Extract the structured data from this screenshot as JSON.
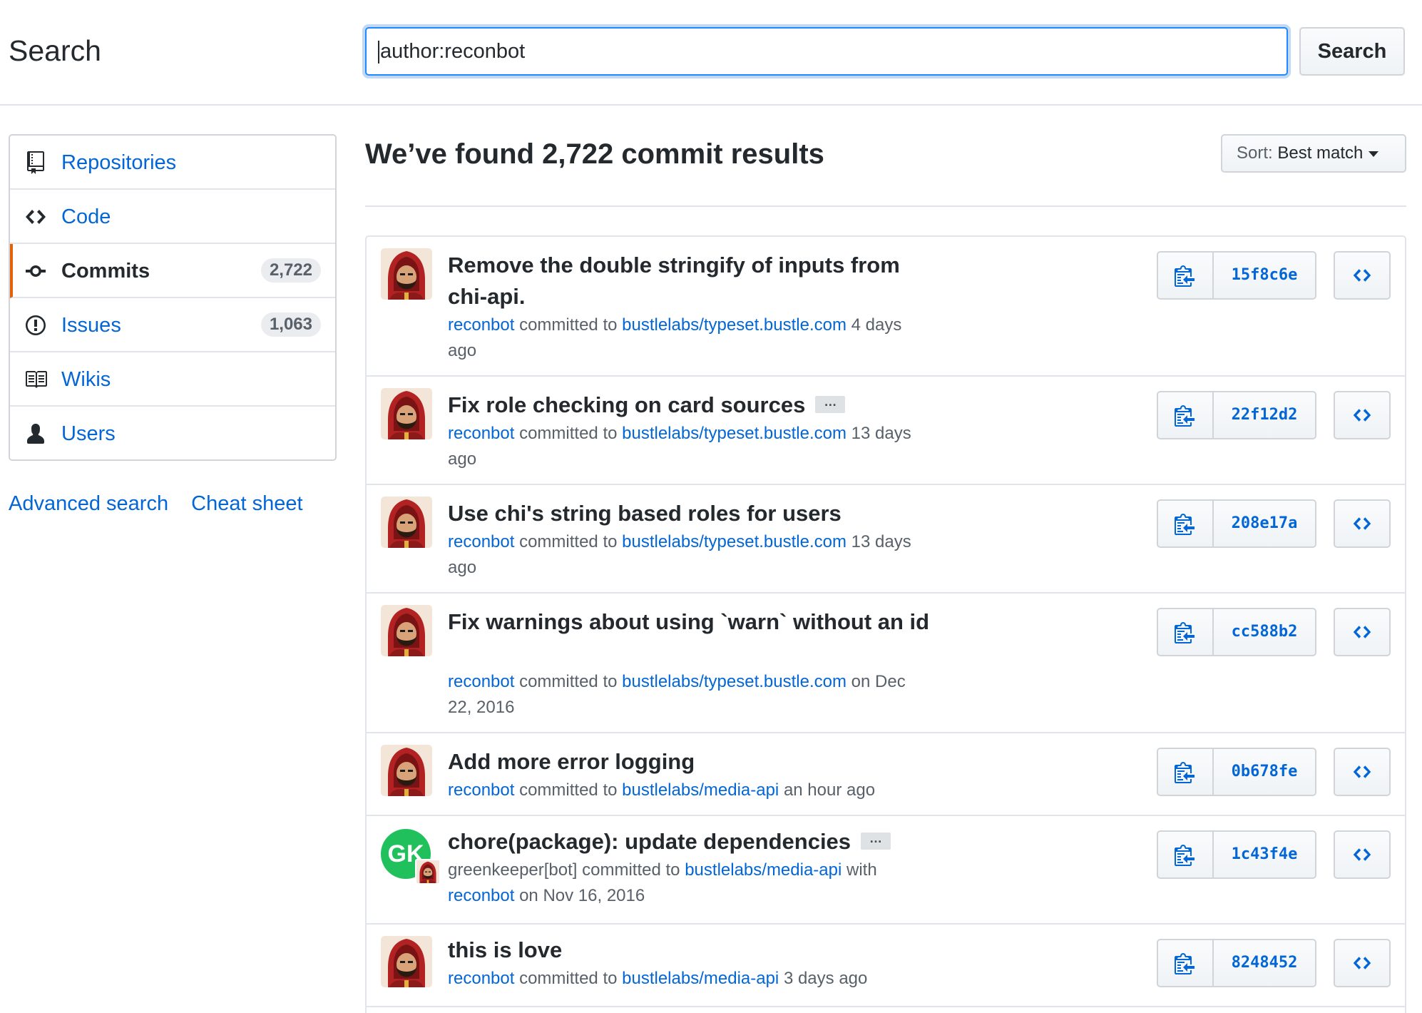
{
  "header": {
    "title": "Search",
    "query": "author:reconbot",
    "search_button": "Search"
  },
  "sidebar": {
    "items": [
      {
        "label": "Repositories",
        "icon": "repo-icon"
      },
      {
        "label": "Code",
        "icon": "code-icon"
      },
      {
        "label": "Commits",
        "icon": "commit-icon",
        "count": "2,722",
        "selected": true
      },
      {
        "label": "Issues",
        "icon": "issue-icon",
        "count": "1,063"
      },
      {
        "label": "Wikis",
        "icon": "book-icon"
      },
      {
        "label": "Users",
        "icon": "person-icon"
      }
    ],
    "links": {
      "advanced": "Advanced search",
      "cheat": "Cheat sheet"
    }
  },
  "main": {
    "results_title": "We’ve found 2,722 commit results",
    "sort_prefix": "Sort:",
    "sort_value": "Best match"
  },
  "commits": [
    {
      "title": "Remove the double stringify of inputs from chi-api.",
      "author": "reconbot",
      "verb": "committed to",
      "repo": "bustlelabs/typeset.bustle.com",
      "time": "4 days ago",
      "sha": "15f8c6e"
    },
    {
      "title": "Fix role checking on card sources",
      "has_more": true,
      "author": "reconbot",
      "verb": "committed to",
      "repo": "bustlelabs/typeset.bustle.com",
      "time": "13 days ago",
      "sha": "22f12d2"
    },
    {
      "title": "Use chi's string based roles for users",
      "author": "reconbot",
      "verb": "committed to",
      "repo": "bustlelabs/typeset.bustle.com",
      "time": "13 days ago",
      "sha": "208e17a"
    },
    {
      "title": "Fix warnings about using `warn` without an id",
      "author": "reconbot",
      "verb": "committed to",
      "repo": "bustlelabs/typeset.bustle.com",
      "time": "on Dec 22, 2016",
      "sha": "cc588b2"
    },
    {
      "title": "Add more error logging",
      "author": "reconbot",
      "verb": "committed to",
      "repo": "bustlelabs/media-api",
      "time": "an hour ago",
      "sha": "0b678fe"
    },
    {
      "title": "chore(package): update dependencies",
      "has_more": true,
      "author": "greenkeeper[bot]",
      "verb": "committed to",
      "repo": "bustlelabs/media-api",
      "with": "with",
      "coauthor": "reconbot",
      "time": "on Nov 16, 2016",
      "sha": "1c43f4e",
      "avatar_text": "GK"
    },
    {
      "title": "this is love",
      "author": "reconbot",
      "verb": "committed to",
      "repo": "bustlelabs/media-api",
      "time": "3 days ago",
      "sha": "8248452"
    }
  ],
  "colors": {
    "link": "#0366d6",
    "accent_orange": "#e36209",
    "focus_blue": "#2188ff",
    "gk_green": "#20c05c"
  }
}
